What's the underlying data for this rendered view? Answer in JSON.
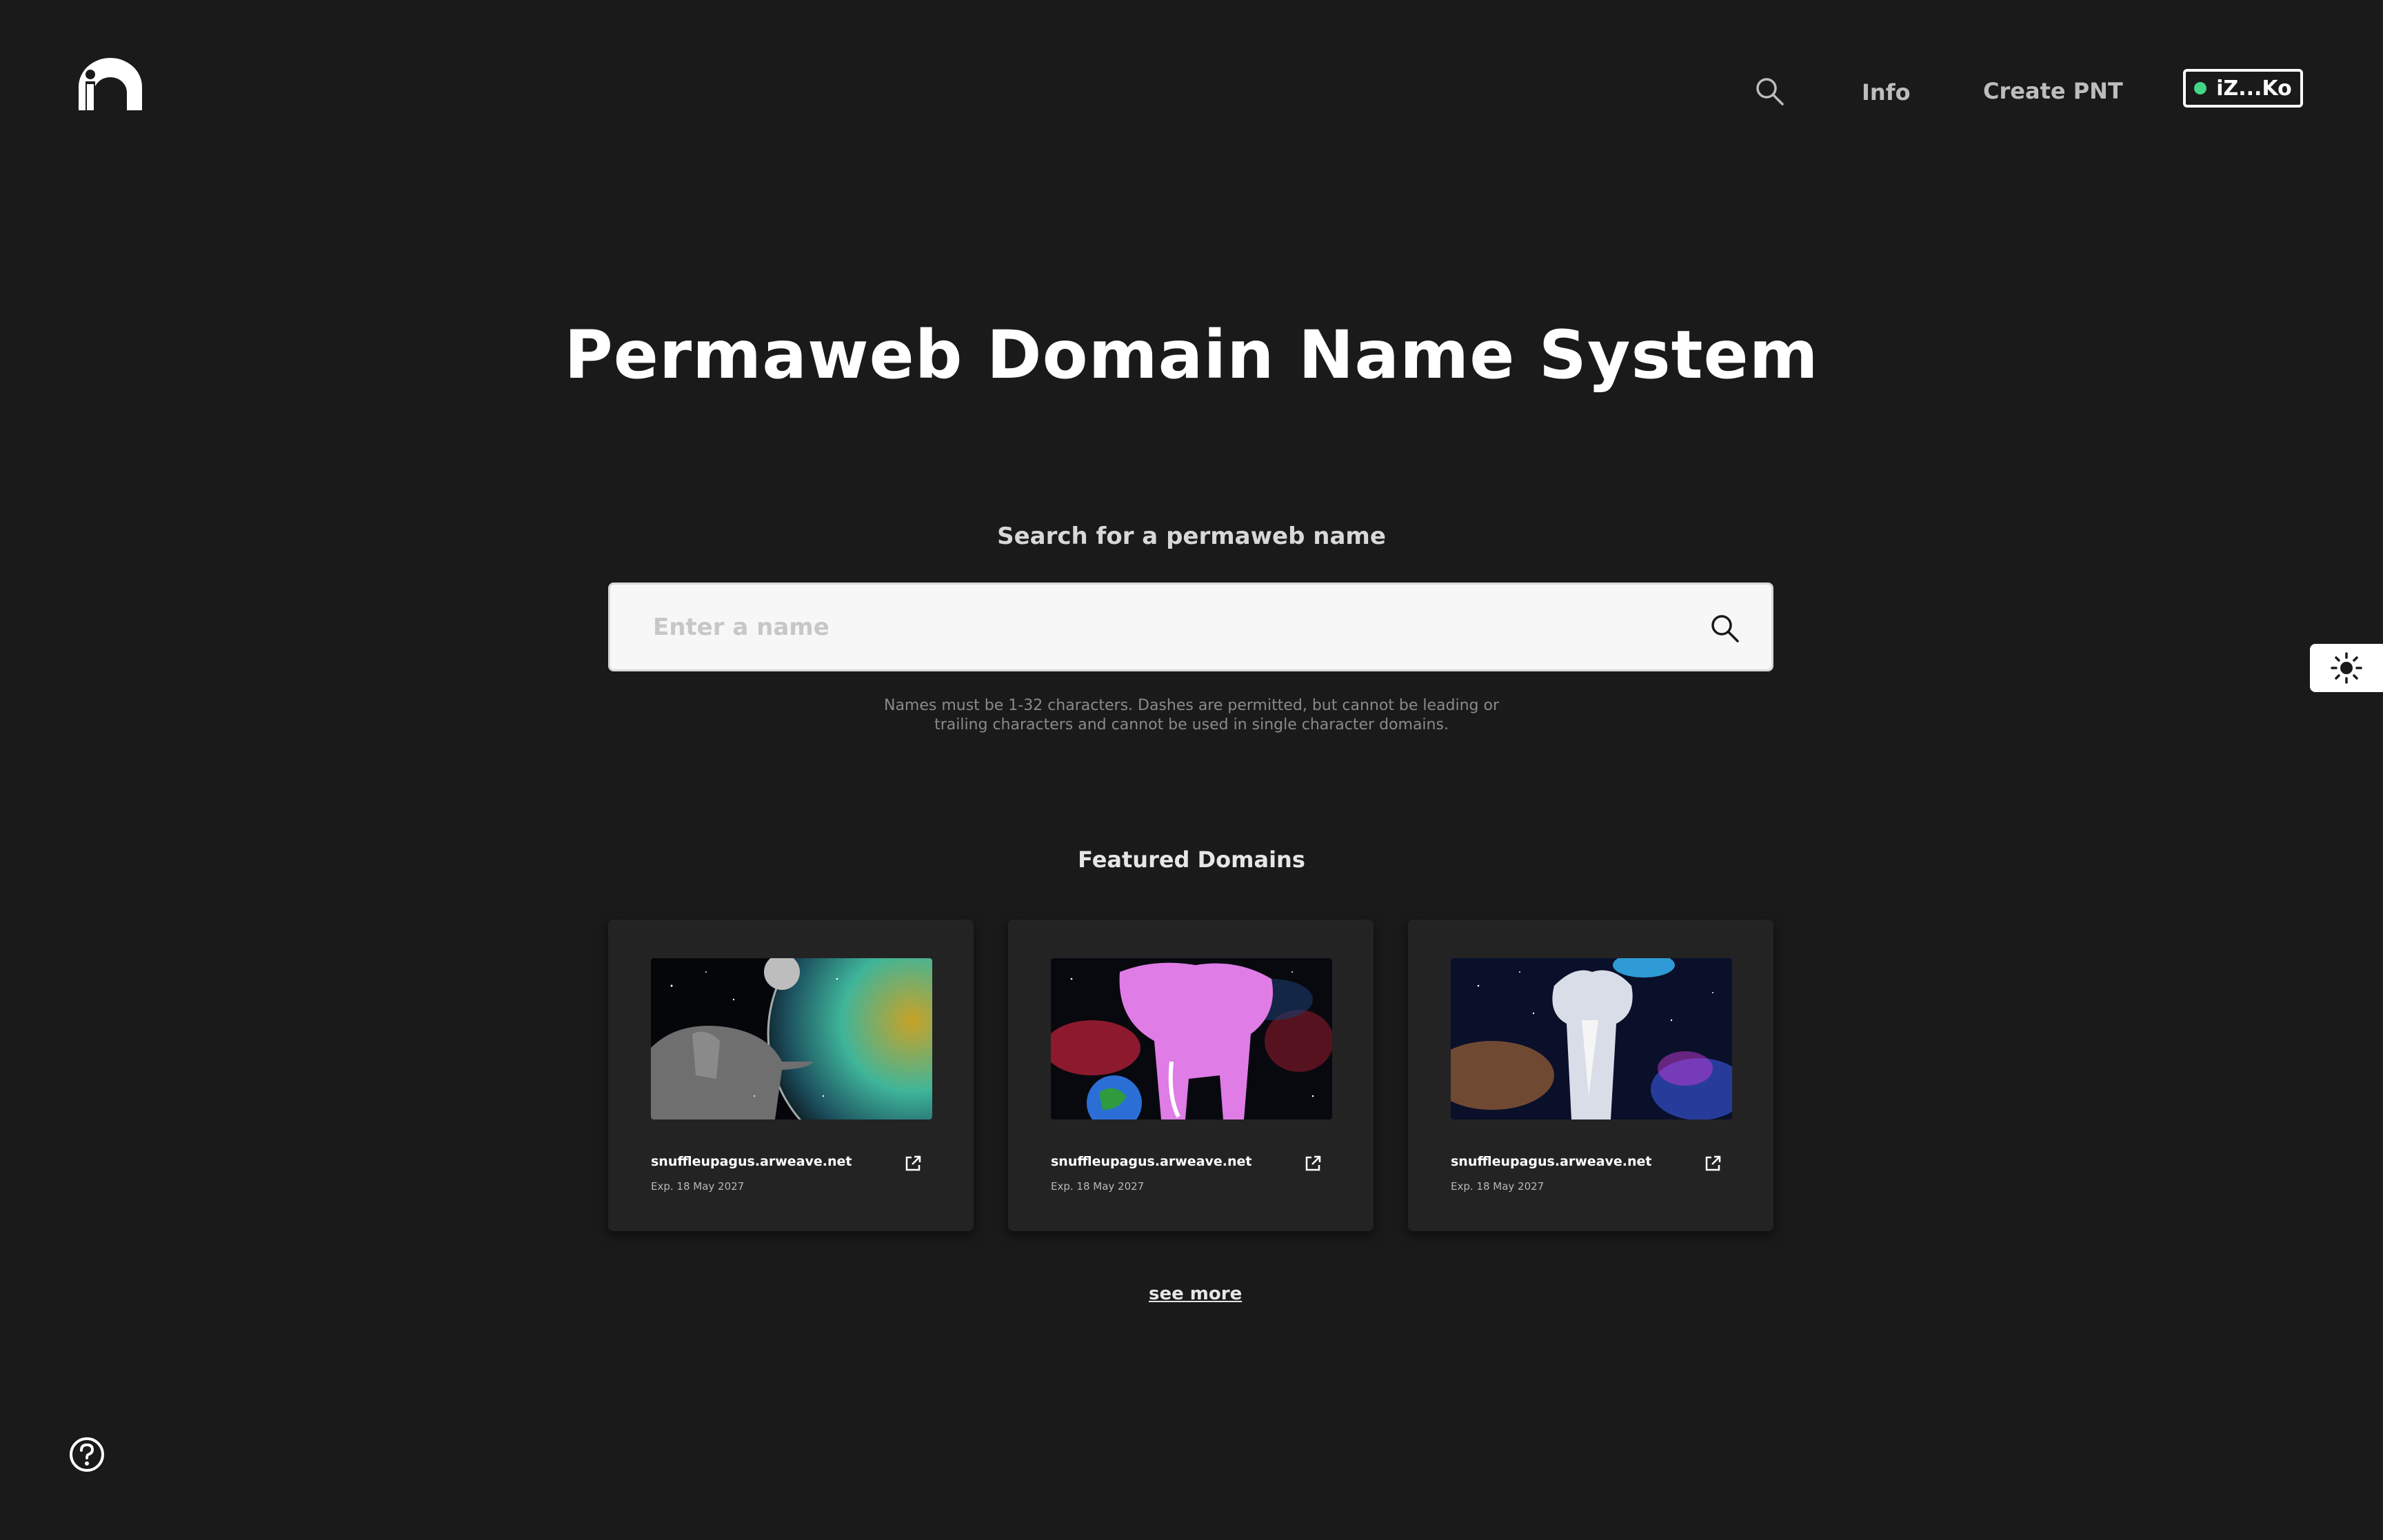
{
  "header": {
    "logo_icon": "arns-logo-icon",
    "search_icon": "search-icon",
    "nav": [
      {
        "label": "Info"
      },
      {
        "label": "Create PNT"
      }
    ],
    "wallet": {
      "address": "iZ...Ko",
      "status_color": "#44d688"
    }
  },
  "hero": {
    "title": "Permaweb Domain Name System"
  },
  "search": {
    "label": "Search for a permaweb name",
    "placeholder": "Enter a name",
    "value": "",
    "hint_line1": "Names must be 1-32 characters. Dashes are permitted, but cannot be leading or",
    "hint_line2": "trailing characters and cannot be used in single character domains."
  },
  "featured": {
    "title": "Featured Domains",
    "cards": [
      {
        "name": "snuffleupagus.arweave.net",
        "expiry": "Exp. 18 May 2027",
        "image": "gray-elephant-space-planet-image"
      },
      {
        "name": "snuffleupagus.arweave.net",
        "expiry": "Exp. 18 May 2027",
        "image": "pink-elephant-nebula-image"
      },
      {
        "name": "snuffleupagus.arweave.net",
        "expiry": "Exp. 18 May 2027",
        "image": "white-elephant-galaxy-image"
      }
    ],
    "see_more": "see more"
  },
  "side": {
    "theme_icon": "sun-icon",
    "help_icon": "help-icon"
  },
  "colors": {
    "background": "#1a1a1a",
    "card": "#232323",
    "accent": "#44d688"
  }
}
